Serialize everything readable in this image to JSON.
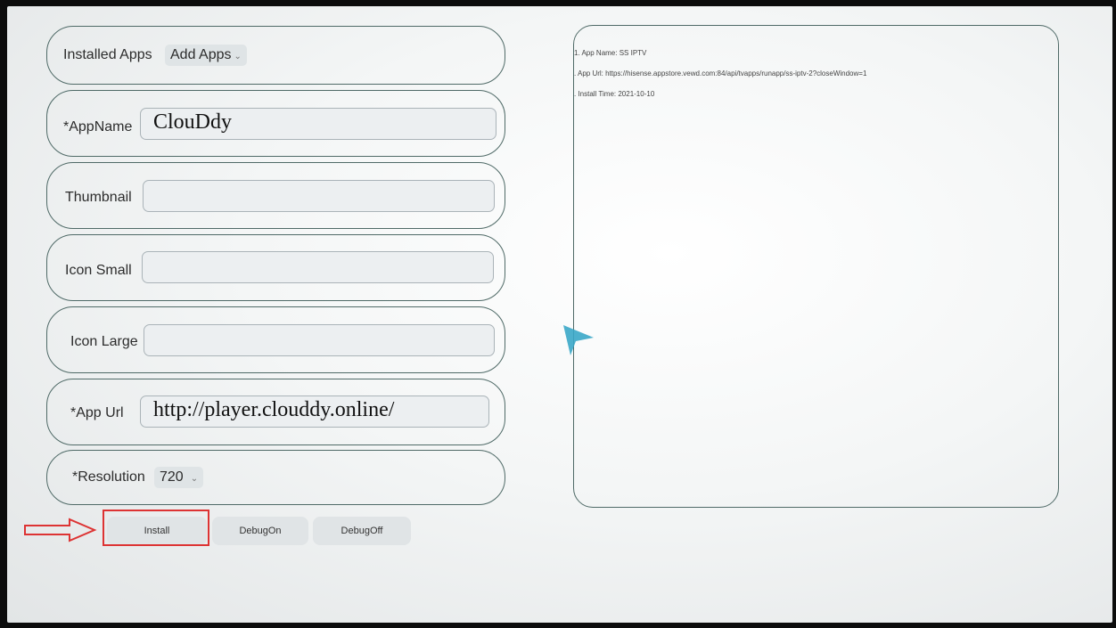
{
  "form": {
    "installed_apps_label": "Installed Apps",
    "add_apps_label": "Add Apps",
    "appname_label": "*AppName",
    "appname_value": "ClouDdy",
    "thumbnail_label": "Thumbnail",
    "thumbnail_value": "",
    "icon_small_label": "Icon Small",
    "icon_small_value": "",
    "icon_large_label": "Icon Large",
    "icon_large_value": "",
    "app_url_label": "*App Url",
    "app_url_value": "http://player.clouddy.online/",
    "resolution_label": "*Resolution",
    "resolution_value": "720"
  },
  "buttons": {
    "install": "Install",
    "debug_on": "DebugOn",
    "debug_off": "DebugOff"
  },
  "log": {
    "lines": [
      "1. App Name: SS IPTV",
      ". App Url: https://hisense.appstore.vewd.com:84/api/tvapps/runapp/ss-iptv-2?closeWindow=1",
      ". Install Time: 2021-10-10"
    ]
  },
  "colors": {
    "card_border": "#4f6a67",
    "highlight": "#dd3333",
    "pointer": "#3aa7c8"
  }
}
